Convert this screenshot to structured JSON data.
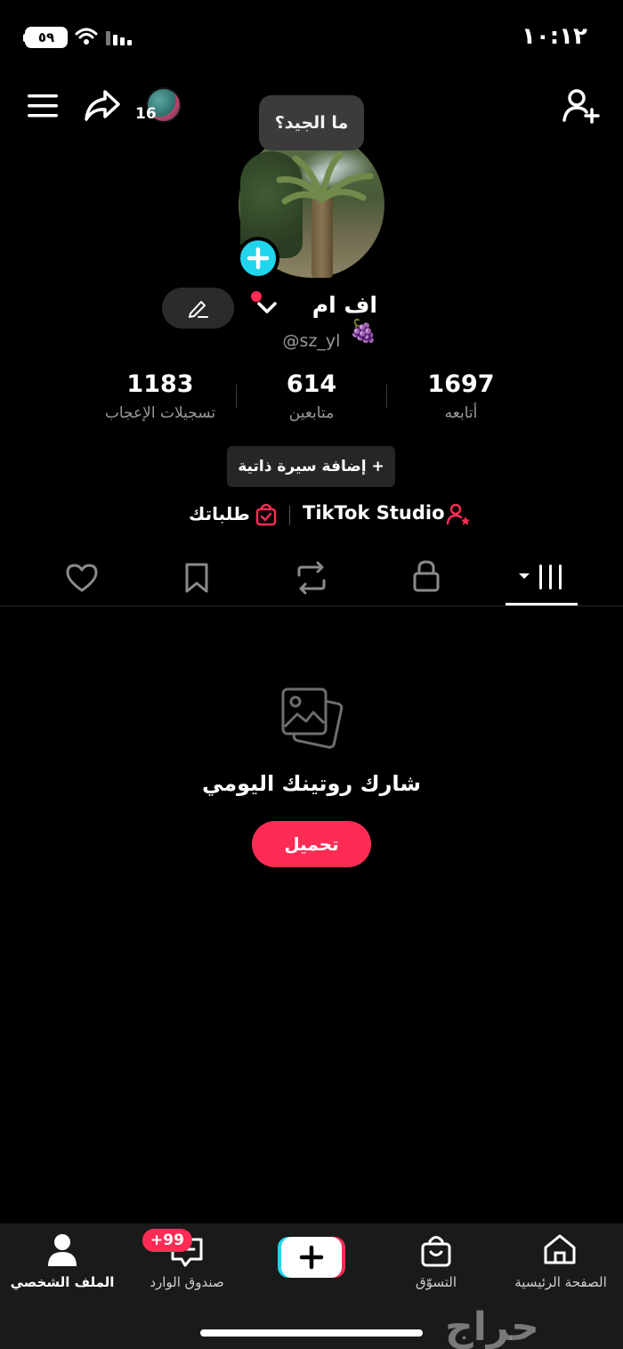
{
  "status_bar": {
    "time": "١٠:١٢",
    "battery": "٥٩"
  },
  "top_bar": {
    "story_count": "16"
  },
  "profile": {
    "bubble_text": "ما الجيد؟",
    "display_name": "اف ام 🍇",
    "username": "@sz_yl"
  },
  "stats": [
    {
      "value": "1697",
      "label": "أتابعه"
    },
    {
      "value": "614",
      "label": "متابعين"
    },
    {
      "value": "1183",
      "label": "تسجيلات الإعجاب"
    }
  ],
  "bio_button": "+ إضافة سيرة ذاتية",
  "links": {
    "studio": "TikTok Studio",
    "orders": "طلباتك"
  },
  "empty_state": {
    "title": "شارك روتينك اليومي",
    "upload": "تحميل"
  },
  "bottom_nav": {
    "home": "الصفحة الرئيسية",
    "shop": "التسوّق",
    "inbox": "صندوق الوارد",
    "profile": "الملف الشخصي",
    "inbox_badge": "+99"
  },
  "watermark": "حراج",
  "colors": {
    "accent": "#fe2c55",
    "cyan": "#20d5ec",
    "background": "#000000"
  }
}
